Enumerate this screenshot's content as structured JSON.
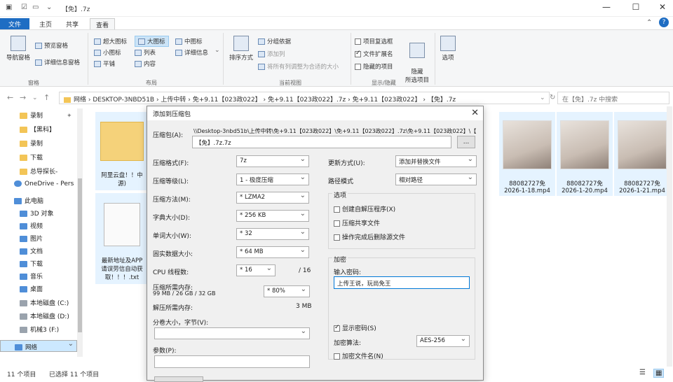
{
  "window": {
    "title": "【免】.7z",
    "min": "—",
    "max": "☐",
    "close": "✕"
  },
  "ribbon_tabs": [
    "文件",
    "主页",
    "共享",
    "查看"
  ],
  "ribbon": {
    "nav_pane": "导航窗格",
    "preview_pane": "预览窗格",
    "details_pane": "详细信息窗格",
    "group_panes": "窗格",
    "layout": [
      "超大图标",
      "大图标",
      "中图标",
      "小图标",
      "列表",
      "详细信息",
      "平铺",
      "内容"
    ],
    "group_layout": "布局",
    "sort": "排序方式",
    "group_by": "分组依据",
    "add_col": "添加列",
    "fit_cols": "将所有列调整为合适的大小",
    "group_view": "当前视图",
    "item_checkbox": "项目复选框",
    "file_ext": "文件扩展名",
    "hidden_items": "隐藏的项目",
    "hide_selected": "隐藏\n所选项目",
    "options": "选项",
    "group_showhide": "显示/隐藏"
  },
  "address": {
    "path": "网络  ›  DESKTOP-3NBD51B  ›  上传中转  ›  免+9.11【023政022】  ›  免+9.11【023政022】.7z  ›  免+9.11【023政022】  ›  【免】.7z",
    "search_placeholder": "在【免】.7z 中搜索"
  },
  "sidebar": [
    {
      "label": "录制",
      "icon": "folder"
    },
    {
      "label": "【黑科】",
      "icon": "folder"
    },
    {
      "label": "录制",
      "icon": "folder"
    },
    {
      "label": "下载",
      "icon": "folder"
    },
    {
      "label": "总导探长-",
      "icon": "folder"
    },
    {
      "label": "OneDrive - Pers",
      "icon": "cloud"
    },
    {
      "label": "此电脑",
      "icon": "pc"
    },
    {
      "label": "3D 对象",
      "icon": "cube"
    },
    {
      "label": "视频",
      "icon": "video"
    },
    {
      "label": "图片",
      "icon": "picture"
    },
    {
      "label": "文档",
      "icon": "document"
    },
    {
      "label": "下载",
      "icon": "download"
    },
    {
      "label": "音乐",
      "icon": "music"
    },
    {
      "label": "桌面",
      "icon": "desktop"
    },
    {
      "label": "本地磁盘 (C:)",
      "icon": "drive"
    },
    {
      "label": "本地磁盘 (D:)",
      "icon": "drive"
    },
    {
      "label": "机械3 (F:)",
      "icon": "drive"
    },
    {
      "label": "网络",
      "icon": "network"
    }
  ],
  "files": [
    {
      "name": "阿里云盘！！中\n源)",
      "type": "folder"
    },
    {
      "name": "最新地址及APP\n请误劳信自动获\n取！！！.txt",
      "type": "txt"
    },
    {
      "name": "88082727免\n2026-1-18.mp4",
      "type": "video"
    },
    {
      "name": "88082727免\n2026-1-20.mp4",
      "type": "video"
    },
    {
      "name": "88082727免\n2026-1-21.mp4",
      "type": "video"
    }
  ],
  "status": {
    "count": "11 个项目",
    "selected": "已选择 11 个项目"
  },
  "dialog": {
    "title": "添加到压缩包",
    "archive_label": "压缩包(A):",
    "archive_path": "\\\\Desktop-3nbd51b\\上传中转\\免+9.11【023政022】\\免+9.11【023政022】.7z\\免+9.11【023政022】\\【",
    "archive_name": "【免】.7z.7z",
    "browse": "...",
    "format_label": "压缩格式(F):",
    "format": "7z",
    "level_label": "压缩等级(L):",
    "level": "1 - 极度压缩",
    "method_label": "压缩方法(M):",
    "method": "* LZMA2",
    "dict_label": "字典大小(D):",
    "dict": "* 256 KB",
    "word_label": "单词大小(W):",
    "word": "* 32",
    "solid_label": "固实数据大小:",
    "solid": "* 64 MB",
    "cpu_label": "CPU 线程数:",
    "cpu": "* 16",
    "cpu_max": "/ 16",
    "mem_label": "压缩所需内存:",
    "mem_value": "99 MB / 26 GB / 32 GB",
    "mem_pct": "* 80%",
    "decomp_label": "解压所需内存:",
    "decomp_value": "3 MB",
    "split_label": "分卷大小，字节(V):",
    "params_label": "参数(P):",
    "update_label": "更新方式(U):",
    "update": "添加并替换文件",
    "path_label": "路径模式",
    "path": "相对路径",
    "options_title": "选项",
    "opt_sfx": "创建自解压程序(X)",
    "opt_shared": "压缩共享文件",
    "opt_delete": "操作完成后删除源文件",
    "enc_title": "加密",
    "pw_label": "输入密码:",
    "pw_value": "上传王说，玩尚免王",
    "show_pw": "显示密码(S)",
    "enc_method_label": "加密算法:",
    "enc_method": "AES-256",
    "enc_names": "加密文件名(N)"
  }
}
